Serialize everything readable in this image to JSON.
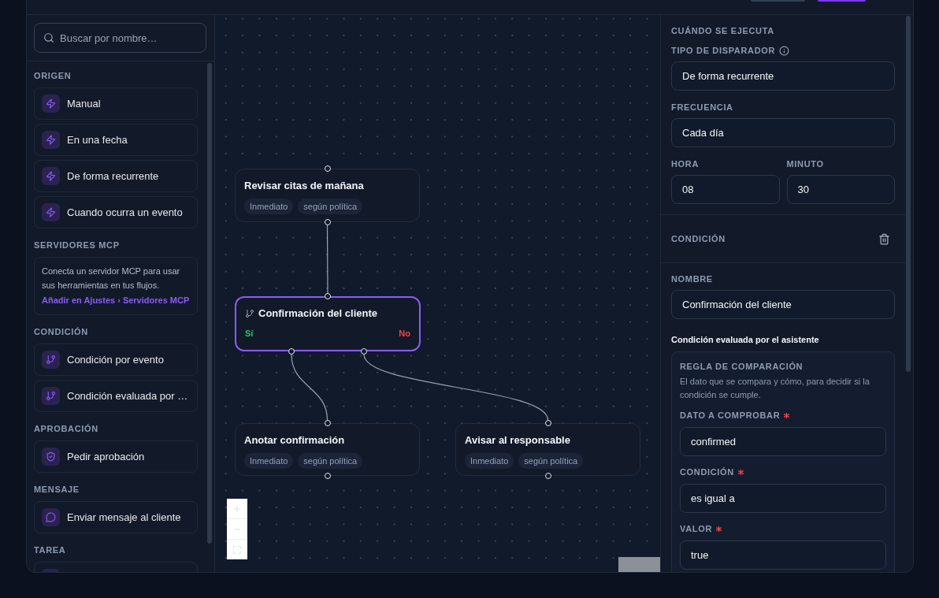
{
  "sidebar": {
    "search": {
      "placeholder": "Buscar por nombre…"
    },
    "sections": [
      {
        "title": "ORIGEN",
        "items": [
          {
            "kind": "trigger",
            "label": "Manual"
          },
          {
            "kind": "trigger",
            "label": "En una fecha"
          },
          {
            "kind": "trigger",
            "label": "De forma recurrente"
          },
          {
            "kind": "trigger",
            "label": "Cuando ocurra un evento"
          }
        ]
      },
      {
        "title": "SERVIDORES MCP",
        "note": {
          "text": "Conecta un servidor MCP para usar sus herramientas en tus flujos.",
          "link": "Añadir en Ajustes › Servidores MCP"
        }
      },
      {
        "title": "CONDICIÓN",
        "items": [
          {
            "kind": "condition",
            "label": "Condición por evento"
          },
          {
            "kind": "condition",
            "label": "Condición evaluada por …"
          }
        ]
      },
      {
        "title": "APROBACIÓN",
        "items": [
          {
            "kind": "approval",
            "label": "Pedir aprobación"
          }
        ]
      },
      {
        "title": "MENSAJE",
        "items": [
          {
            "kind": "message",
            "label": "Enviar mensaje al cliente"
          }
        ]
      },
      {
        "title": "TAREA",
        "items": [
          {
            "kind": "task"
          }
        ]
      }
    ]
  },
  "canvas": {
    "nodes": [
      {
        "kind": "action",
        "title": "Revisar citas de mañana",
        "tags": [
          "Inmediato",
          "según política"
        ],
        "selected": false
      },
      {
        "kind": "condition",
        "title": "Confirmación del cliente",
        "selected": true,
        "branches": [
          {
            "label": "Sí",
            "color": "#22c55e"
          },
          {
            "label": "No",
            "color": "#ef4444"
          }
        ]
      },
      {
        "kind": "action",
        "title": "Anotar confirmación",
        "tags": [
          "Inmediato",
          "según política"
        ],
        "selected": false
      },
      {
        "kind": "action",
        "title": "Avisar al responsable",
        "tags": [
          "Inmediato",
          "según política"
        ],
        "selected": false
      }
    ]
  },
  "inspector": {
    "schedule": {
      "title": "CUÁNDO SE EJECUTA",
      "fields": [
        {
          "label": "TIPO DE DISPARADOR",
          "value": "De forma recurrente",
          "info": true
        },
        {
          "label": "FRECUENCIA",
          "value": "Cada día"
        }
      ],
      "time": [
        {
          "label": "HORA",
          "value": "08"
        },
        {
          "label": "MINUTO",
          "value": "30"
        }
      ]
    },
    "condition": {
      "title": "CONDICIÓN",
      "name": {
        "label": "NOMBRE",
        "value": "Confirmación del cliente"
      },
      "evaluator": "Condición evaluada por el asistente",
      "rule": {
        "title": "REGLA DE COMPARACIÓN",
        "description": "El dato que se compara y cómo, para decidir si la condición se cumple.",
        "fields": [
          {
            "label": "DATO A COMPROBAR",
            "value": "confirmed",
            "required": true
          },
          {
            "label": "CONDICIÓN",
            "value": "es igual a",
            "required": true
          },
          {
            "label": "VALOR",
            "value": "true",
            "required": true
          }
        ]
      }
    }
  }
}
